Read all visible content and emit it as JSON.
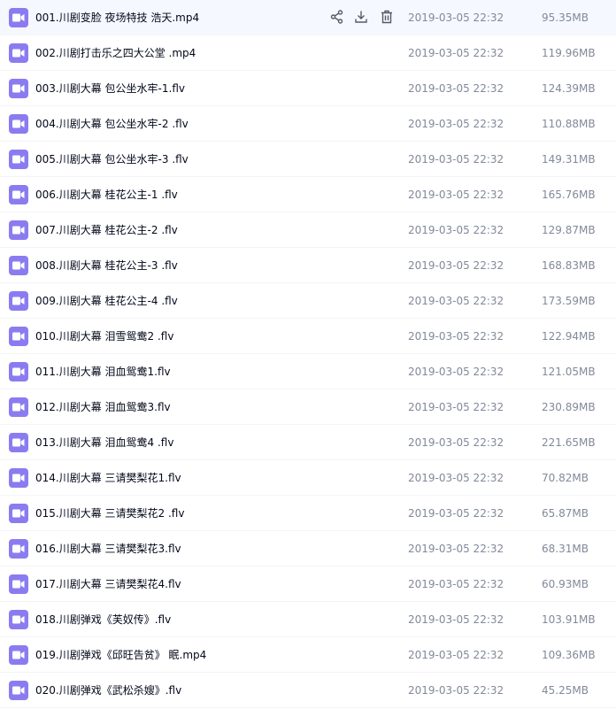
{
  "files": [
    {
      "name": "001.川剧变脸 夜场特技 浩天.mp4",
      "date": "2019-03-05 22:32",
      "size": "95.35MB",
      "hovered": true
    },
    {
      "name": "002.川剧打击乐之四大公堂 .mp4",
      "date": "2019-03-05 22:32",
      "size": "119.96MB"
    },
    {
      "name": "003.川剧大幕 包公坐水牢-1.flv",
      "date": "2019-03-05 22:32",
      "size": "124.39MB"
    },
    {
      "name": "004.川剧大幕 包公坐水牢-2 .flv",
      "date": "2019-03-05 22:32",
      "size": "110.88MB"
    },
    {
      "name": "005.川剧大幕 包公坐水牢-3 .flv",
      "date": "2019-03-05 22:32",
      "size": "149.31MB"
    },
    {
      "name": "006.川剧大幕 桂花公主-1 .flv",
      "date": "2019-03-05 22:32",
      "size": "165.76MB"
    },
    {
      "name": "007.川剧大幕 桂花公主-2 .flv",
      "date": "2019-03-05 22:32",
      "size": "129.87MB"
    },
    {
      "name": "008.川剧大幕 桂花公主-3 .flv",
      "date": "2019-03-05 22:32",
      "size": "168.83MB"
    },
    {
      "name": "009.川剧大幕 桂花公主-4 .flv",
      "date": "2019-03-05 22:32",
      "size": "173.59MB"
    },
    {
      "name": "010.川剧大幕 泪雪鸳鸯2 .flv",
      "date": "2019-03-05 22:32",
      "size": "122.94MB"
    },
    {
      "name": "011.川剧大幕 泪血鸳鸯1.flv",
      "date": "2019-03-05 22:32",
      "size": "121.05MB"
    },
    {
      "name": "012.川剧大幕 泪血鸳鸯3.flv",
      "date": "2019-03-05 22:32",
      "size": "230.89MB"
    },
    {
      "name": "013.川剧大幕 泪血鸳鸯4 .flv",
      "date": "2019-03-05 22:32",
      "size": "221.65MB"
    },
    {
      "name": "014.川剧大幕 三请樊梨花1.flv",
      "date": "2019-03-05 22:32",
      "size": "70.82MB"
    },
    {
      "name": "015.川剧大幕 三请樊梨花2 .flv",
      "date": "2019-03-05 22:32",
      "size": "65.87MB"
    },
    {
      "name": "016.川剧大幕 三请樊梨花3.flv",
      "date": "2019-03-05 22:32",
      "size": "68.31MB"
    },
    {
      "name": "017.川剧大幕 三请樊梨花4.flv",
      "date": "2019-03-05 22:32",
      "size": "60.93MB"
    },
    {
      "name": "018.川剧弹戏《芙奴传》.flv",
      "date": "2019-03-05 22:32",
      "size": "103.91MB"
    },
    {
      "name": "019.川剧弹戏《邱旺告贫》 眠.mp4",
      "date": "2019-03-05 22:32",
      "size": "109.36MB"
    },
    {
      "name": "020.川剧弹戏《武松杀嫂》.flv",
      "date": "2019-03-05 22:32",
      "size": "45.25MB"
    }
  ],
  "icons": {
    "file": "video-file-icon",
    "share": "share-icon",
    "download": "download-icon",
    "delete": "trash-icon"
  },
  "colors": {
    "file_icon": "#8a7cf0",
    "hover_row": "#f5f8ff",
    "meta_text": "#818999"
  }
}
